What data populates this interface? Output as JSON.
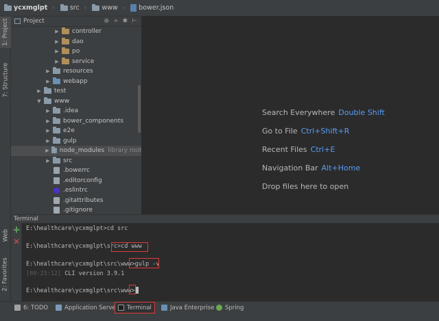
{
  "breadcrumb": [
    {
      "label": "ycxmglpt",
      "icon": "folder-icon",
      "bold": true
    },
    {
      "label": "src",
      "icon": "folder-icon"
    },
    {
      "label": "www",
      "icon": "folder-icon"
    },
    {
      "label": "bower.json",
      "icon": "json-file-icon"
    }
  ],
  "left_stripe": {
    "project_tab": "1: Project",
    "structure_tab": "7: Structure",
    "web_tab": "Web",
    "favorites_tab": "2: Favorites"
  },
  "project_panel": {
    "title": "Project",
    "tools": [
      "⊕",
      "÷",
      "✱",
      "⊢"
    ],
    "tree": [
      {
        "label": "controller",
        "level": 3,
        "expanded": false,
        "icon": "pkg"
      },
      {
        "label": "dao",
        "level": 3,
        "expanded": false,
        "icon": "pkg"
      },
      {
        "label": "po",
        "level": 3,
        "expanded": false,
        "icon": "pkg"
      },
      {
        "label": "service",
        "level": 3,
        "expanded": false,
        "icon": "pkg"
      },
      {
        "label": "resources",
        "level": 2,
        "expanded": false,
        "icon": "folder"
      },
      {
        "label": "webapp",
        "level": 2,
        "expanded": false,
        "icon": "web"
      },
      {
        "label": "test",
        "level": 1,
        "expanded": false,
        "icon": "folder"
      },
      {
        "label": "www",
        "level": 1,
        "expanded": true,
        "icon": "folder"
      },
      {
        "label": ".idea",
        "level": 2,
        "expanded": false,
        "icon": "folder"
      },
      {
        "label": "bower_components",
        "level": 2,
        "expanded": false,
        "icon": "folder"
      },
      {
        "label": "e2e",
        "level": 2,
        "expanded": false,
        "icon": "folder"
      },
      {
        "label": "gulp",
        "level": 2,
        "expanded": false,
        "icon": "folder"
      },
      {
        "label": "node_modules",
        "level": 2,
        "expanded": false,
        "icon": "folder",
        "hint": "library root",
        "selected": true
      },
      {
        "label": "src",
        "level": 2,
        "expanded": false,
        "icon": "folder"
      },
      {
        "label": ".bowerrc",
        "level": 2,
        "file": true,
        "icon": "file"
      },
      {
        "label": ".editorconfig",
        "level": 2,
        "file": true,
        "icon": "file"
      },
      {
        "label": ".eslintrc",
        "level": 2,
        "file": true,
        "icon": "eslint"
      },
      {
        "label": ".gitattributes",
        "level": 2,
        "file": true,
        "icon": "git"
      },
      {
        "label": ".gitignore",
        "level": 2,
        "file": true,
        "icon": "git"
      }
    ]
  },
  "editor_hints": [
    {
      "label": "Search Everywhere",
      "key": "Double Shift"
    },
    {
      "label": "Go to File",
      "key": "Ctrl+Shift+R"
    },
    {
      "label": "Recent Files",
      "key": "Ctrl+E"
    },
    {
      "label": "Navigation Bar",
      "key": "Alt+Home"
    },
    {
      "label": "Drop files here to open",
      "key": ""
    }
  ],
  "terminal": {
    "title": "Terminal",
    "lines": [
      {
        "prompt": "E:\\healthcare\\ycxmglpt>",
        "cmd": "cd src"
      },
      {
        "prompt": "",
        "cmd": ""
      },
      {
        "prompt": "E:\\healthcare\\ycxmglpt\\src>",
        "cmd": "cd www"
      },
      {
        "prompt": "",
        "cmd": ""
      },
      {
        "prompt": "E:\\healthcare\\ycxmglpt\\src\\www>",
        "cmd": "gulp -v"
      },
      {
        "timestamp": "[00:25:12]",
        "cmd": " CLI version 3.9.1"
      },
      {
        "prompt": "",
        "cmd": ""
      },
      {
        "prompt": "E:\\healthcare\\ycxmglpt\\src\\www>",
        "cmd": "",
        "cursor": true
      }
    ]
  },
  "bottom_tabs": [
    {
      "label": "6: TODO",
      "icon": "todo-icon",
      "color": "#a0a0a0"
    },
    {
      "label": "Application Servers",
      "icon": "servers-icon",
      "color": "#7a9ab8"
    },
    {
      "label": "Terminal",
      "icon": "terminal-icon",
      "color": "#1e1e1e",
      "active": true
    },
    {
      "label": "Java Enterprise",
      "icon": "java-enterprise-icon",
      "color": "#6b8fb5"
    },
    {
      "label": "Spring",
      "icon": "spring-icon",
      "color": "#6aab4f"
    }
  ],
  "colors": {
    "shortcut": "#589df6",
    "highlight_box": "#e23a3a"
  }
}
